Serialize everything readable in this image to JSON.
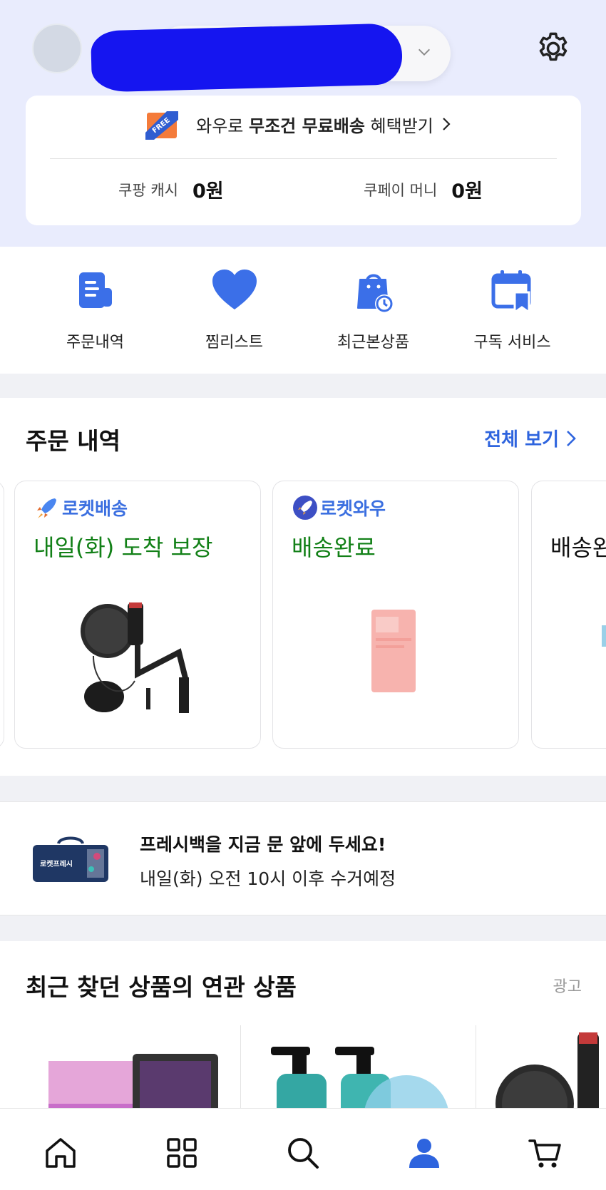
{
  "header": {
    "avatar": "avatar",
    "username_redacted": true,
    "settings_icon": "gear-icon"
  },
  "benefit": {
    "badge_text": "FREE",
    "prefix": "와우로 ",
    "highlight": "무조건 무료배송",
    "suffix": " 혜택받기",
    "cash_label": "쿠팡 캐시",
    "cash_value": "0원",
    "pay_label": "쿠페이 머니",
    "pay_value": "0원"
  },
  "quick_menu": [
    {
      "label": "주문내역",
      "icon": "receipt-icon"
    },
    {
      "label": "찜리스트",
      "icon": "heart-icon"
    },
    {
      "label": "최근본상품",
      "icon": "shopping-bag-clock-icon"
    },
    {
      "label": "구독 서비스",
      "icon": "calendar-bookmark-icon"
    }
  ],
  "orders": {
    "title": "주문 내역",
    "see_all": "전체 보기",
    "cards": [
      {
        "type": "로켓배송",
        "status": "내일(화) 도착 보장",
        "image": "microphone-product"
      },
      {
        "type": "로켓와우",
        "status": "배송완료",
        "image": "pink-package-product"
      },
      {
        "type": "",
        "status": "배송완",
        "image": "product"
      }
    ]
  },
  "fresh": {
    "bag_text": "로켓프레시",
    "title": "프레시백을 지금 문 앞에 두세요!",
    "subtitle": "내일(화) 오전 10시 이후 수거예정"
  },
  "related": {
    "title": "최근 찾던 상품의 연관 상품",
    "ad_label": "광고"
  },
  "tabbar": [
    {
      "name": "home",
      "icon": "home-icon"
    },
    {
      "name": "category",
      "icon": "grid-icon"
    },
    {
      "name": "search",
      "icon": "search-icon"
    },
    {
      "name": "my",
      "icon": "user-icon",
      "active": true
    },
    {
      "name": "cart",
      "icon": "cart-icon"
    }
  ],
  "colors": {
    "accent_blue": "#2e64de",
    "status_green": "#128017",
    "header_bg": "#e9ecfd",
    "redaction": "#1515f0"
  }
}
